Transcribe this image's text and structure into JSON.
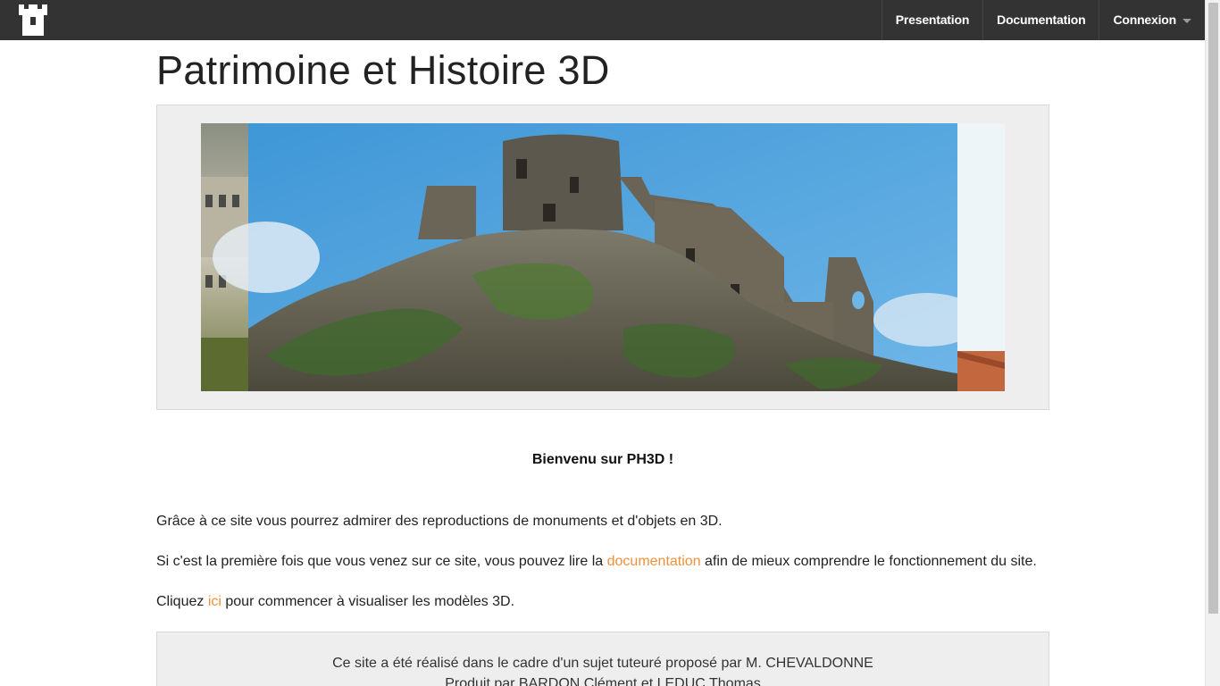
{
  "nav": {
    "logo_icon": "castle-tower-icon",
    "items": [
      {
        "label": "Presentation"
      },
      {
        "label": "Documentation"
      },
      {
        "label": "Connexion",
        "icon": "caret-down-icon"
      }
    ]
  },
  "main": {
    "title": "Patrimoine et Histoire 3D",
    "carousel": {
      "slides": [
        "castle-ruins-photo",
        "chateau-photo",
        "building-photo"
      ]
    },
    "welcome": "Bienvenu sur PH3D !",
    "p1": "Grâce à ce site vous pourrez admirer des reproductions de monuments et d'objets en 3D.",
    "p2_before": "Si c'est la première fois que vous venez sur ce site, vous pouvez lire la ",
    "p2_link": "documentation",
    "p2_after": " afin de mieux comprendre le fonctionnement du site.",
    "p3_before": "Cliquez ",
    "p3_link": "ici",
    "p3_after": " pour commencer à visualiser les modèles 3D."
  },
  "footer": {
    "line1": "Ce site a été réalisé dans le cadre d'un sujet tuteuré proposé par M. CHEVALDONNE",
    "line2": "Produit par BARDON Clément et LEDUC Thomas"
  },
  "colors": {
    "navbar": "#333333",
    "link": "#f0903a",
    "panel": "#eeeeee"
  }
}
